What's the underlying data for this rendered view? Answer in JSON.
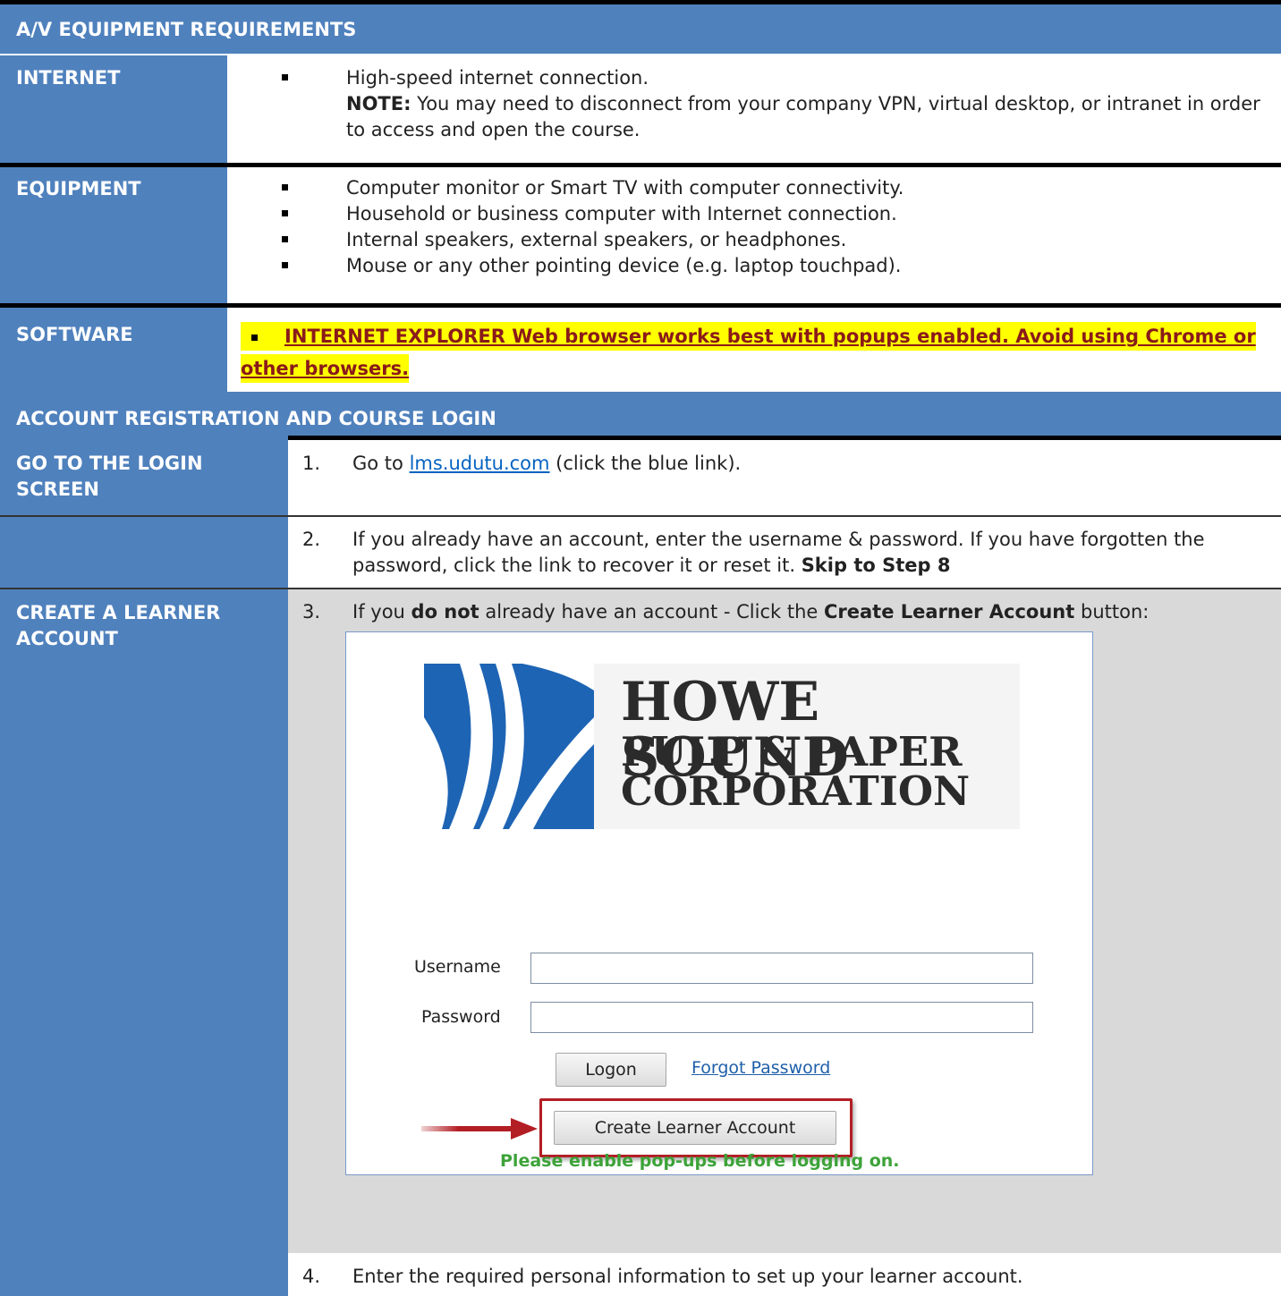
{
  "av_section": {
    "header": "A/V EQUIPMENT REQUIREMENTS",
    "internet": {
      "label": "INTERNET",
      "line1": "High-speed internet connection.",
      "note_label": "NOTE:",
      "note_text": " You may need to disconnect from your company VPN, virtual desktop, or intranet in order to access and open the course."
    },
    "equipment": {
      "label": "EQUIPMENT",
      "items": [
        "Computer monitor or Smart TV with computer connectivity.",
        "Household or business computer with Internet connection.",
        "Internal speakers, external speakers, or headphones.",
        "Mouse or any other pointing device (e.g. laptop touchpad)."
      ]
    },
    "software": {
      "label": "SOFTWARE",
      "text": "INTERNET EXPLORER Web browser works best with popups enabled.  Avoid using Chrome or other browsers.",
      "highlight_color": "#FFFF00"
    }
  },
  "account_section": {
    "header": "ACCOUNT REGISTRATION AND COURSE LOGIN",
    "steps": {
      "step1": {
        "label": "GO TO THE LOGIN SCREEN",
        "num": "1.",
        "pre": "Go to ",
        "link": "lms.udutu.com",
        "post": " (click the blue link)."
      },
      "step2": {
        "num": "2.",
        "text": "If you already have an account, enter the username & password.  If you have forgotten the password, click the link to recover it or reset it. ",
        "bold": "Skip to Step 8"
      },
      "step3": {
        "label": "CREATE A LEARNER ACCOUNT",
        "num": "3.",
        "pre": "If you ",
        "bold1": "do not",
        "mid": " already have an account - Click the ",
        "bold2": "Create Learner Account",
        "post": " button:"
      },
      "step4": {
        "num": "4.",
        "text": "Enter the required personal information to set up your learner account."
      }
    }
  },
  "login_screenshot": {
    "logo_line1": "HOWE SOUND",
    "logo_line2": "PULP & PAPER",
    "logo_line3": "CORPORATION",
    "username_label": "Username",
    "password_label": "Password",
    "logon_button": "Logon",
    "forgot_link": "Forgot Password",
    "create_button": "Create Learner Account",
    "popup_note": "Please enable pop-ups before logging on."
  },
  "colors": {
    "header_blue": "#4F81BD",
    "gray_bg": "#D9D9D9",
    "link_blue": "#0563C1",
    "logo_blue": "#1E64B4",
    "arrow_red": "#B21E24",
    "note_green": "#3DA339"
  }
}
